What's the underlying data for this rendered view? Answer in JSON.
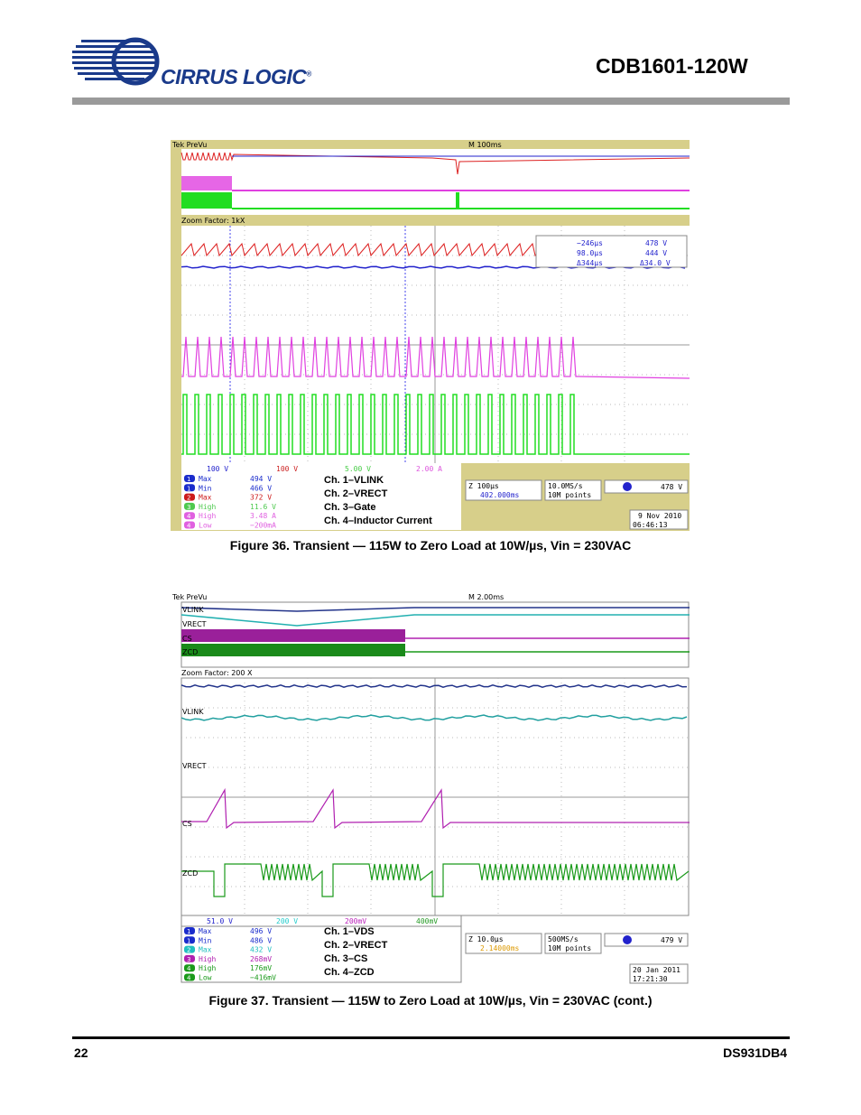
{
  "header": {
    "logo_text": "CIRRUS LOGIC",
    "logo_mark": "®",
    "doc_title": "CDB1601-120W"
  },
  "footer": {
    "page_number": "22",
    "doc_id": "DS931DB4"
  },
  "figure36": {
    "caption": "Figure 36.  Transient — 115W to Zero Load at 10W/µs, Vin = 230VAC",
    "top_bar_left": "Tek PreVu",
    "top_bar_mid": "M 100ms",
    "zoom_label": "Zoom Factor: 1kX",
    "cursor_box": {
      "r1_a": "−246µs",
      "r1_b": "478 V",
      "r2_a": "98.0µs",
      "r2_b": "444 V",
      "r3_a": "Δ344µs",
      "r3_b": "Δ34.0 V"
    },
    "channel_bar": {
      "ch1": "100 V",
      "ch2": "100 V",
      "ch3": "5.00 V",
      "ch4": "2.00 A"
    },
    "measurements": [
      {
        "ch": "1",
        "label": "Max",
        "value": "494 V",
        "color": "#1a2ccc"
      },
      {
        "ch": "1",
        "label": "Min",
        "value": "466 V",
        "color": "#1a2ccc"
      },
      {
        "ch": "2",
        "label": "Max",
        "value": "372 V",
        "color": "#cc1a1a"
      },
      {
        "ch": "3",
        "label": "High",
        "value": "11.6 V",
        "color": "#4ec94e"
      },
      {
        "ch": "4",
        "label": "High",
        "value": "3.48 A",
        "color": "#e060e0"
      },
      {
        "ch": "4",
        "label": "Low",
        "value": "−200mA",
        "color": "#e060e0"
      }
    ],
    "legend": [
      "Ch. 1–VLINK",
      "Ch. 2–VRECT",
      "Ch. 3–Gate",
      "Ch. 4–Inductor Current"
    ],
    "timebase": "Z 100µs",
    "trigger_pos": "402.000ms",
    "sample_rate": "10.0MS/s",
    "record": "10M points",
    "trigger_level": "478 V",
    "date": "9 Nov 2010",
    "time": "06:46:13"
  },
  "figure37": {
    "caption": "Figure 37.  Transient — 115W to Zero Load at 10W/µs, Vin = 230VAC (cont.)",
    "top_bar_left": "Tek PreVu",
    "top_bar_mid": "M 2.00ms",
    "zoom_label": "Zoom Factor: 200 X",
    "trace_labels": [
      "VLINK",
      "VRECT",
      "CS",
      "ZCD"
    ],
    "channel_bar": {
      "ch1": "51.0 V",
      "ch2": "200 V",
      "ch3": "200mV",
      "ch4": "400mV"
    },
    "measurements": [
      {
        "ch": "1",
        "label": "Max",
        "value": "496 V",
        "color": "#1a2ccc"
      },
      {
        "ch": "1",
        "label": "Min",
        "value": "486 V",
        "color": "#1a2ccc"
      },
      {
        "ch": "2",
        "label": "Max",
        "value": "432 V",
        "color": "#22c0c0"
      },
      {
        "ch": "3",
        "label": "High",
        "value": "268mV",
        "color": "#b020b0"
      },
      {
        "ch": "4",
        "label": "High",
        "value": "176mV",
        "color": "#1a9a1a"
      },
      {
        "ch": "4",
        "label": "Low",
        "value": "−416mV",
        "color": "#1a9a1a"
      }
    ],
    "legend": [
      "Ch. 1–VDS",
      "Ch. 2–VRECT",
      "Ch. 3–CS",
      "Ch. 4–ZCD"
    ],
    "timebase": "Z 10.0µs",
    "trigger_pos": "2.14000ms",
    "sample_rate": "500MS/s",
    "record": "10M points",
    "trigger_level": "479 V",
    "date": "20 Jan  2011",
    "time": "17:21:30"
  }
}
